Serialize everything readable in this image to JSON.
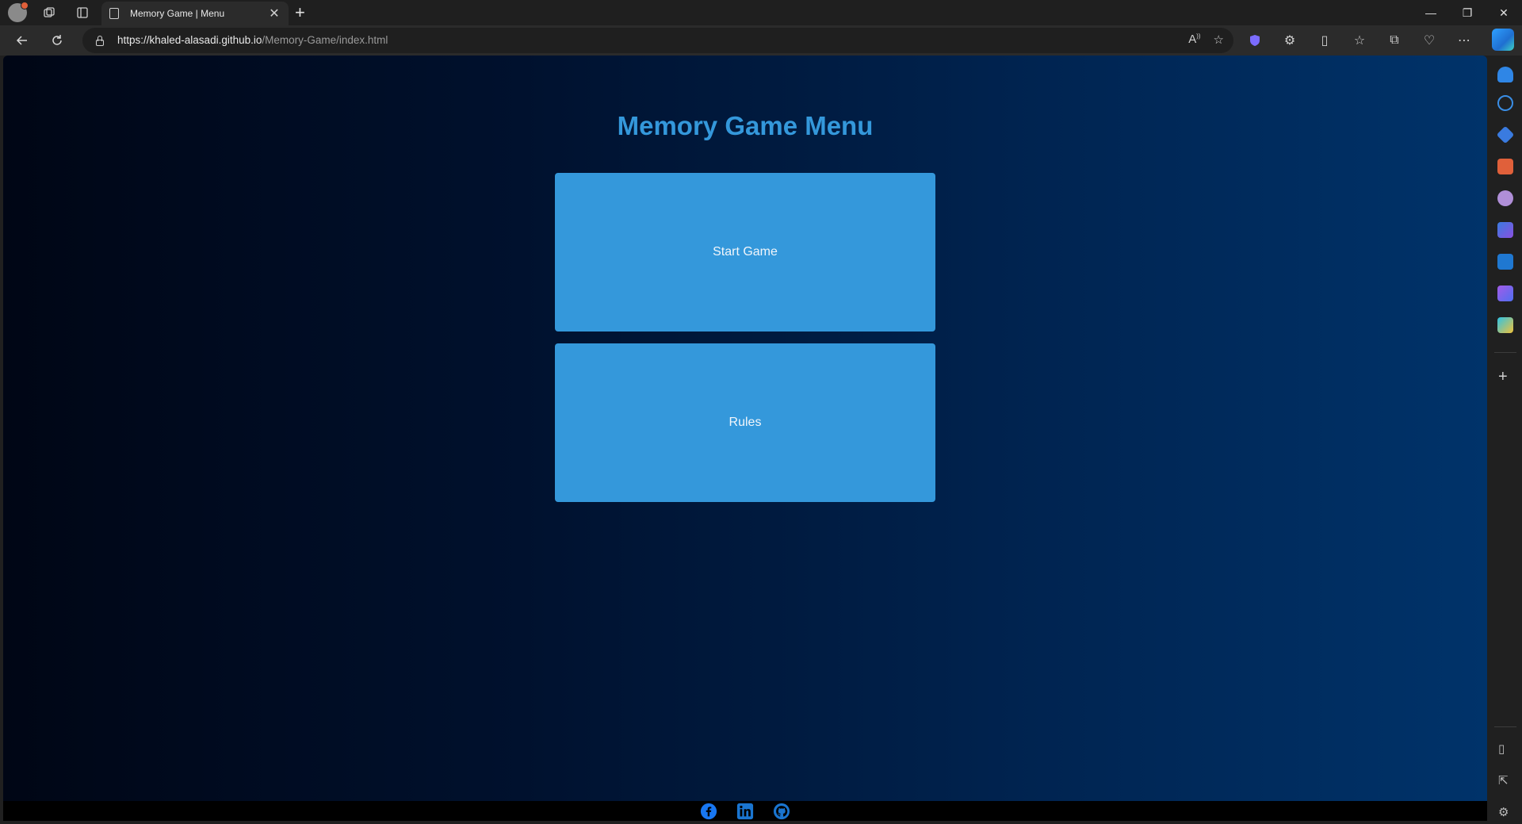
{
  "browser": {
    "tab_title": "Memory Game | Menu",
    "tab_close": "✕",
    "new_tab": "+",
    "url_host": "https://khaled-alasadi.github.io",
    "url_path": "/Memory-Game/index.html",
    "window_controls": [
      "—",
      "❐",
      "✕"
    ],
    "nav_icons": [
      "back-arrow-icon",
      "refresh-icon"
    ],
    "toolbar_icons": [
      "read-aloud-icon",
      "favorite-star-icon",
      "shield-extension-icon",
      "extensions-icon",
      "split-screen-icon",
      "favorites-icon",
      "collections-icon",
      "browser-essentials-icon",
      "more-options-icon"
    ],
    "sidebar_icons": [
      "notifications-icon",
      "search-icon",
      "shopping-icon",
      "tools-icon",
      "games-icon",
      "microsoft-365-icon",
      "outlook-icon",
      "designer-icon",
      "send-icon",
      "add-icon",
      "sidebar-toggle-icon",
      "open-external-icon",
      "settings-icon"
    ]
  },
  "page": {
    "title": "Memory Game Menu",
    "buttons": {
      "start": "Start Game",
      "rules": "Rules"
    },
    "footer_icons": [
      "facebook-icon",
      "linkedin-icon",
      "github-icon"
    ],
    "accent_color": "#3498db"
  }
}
